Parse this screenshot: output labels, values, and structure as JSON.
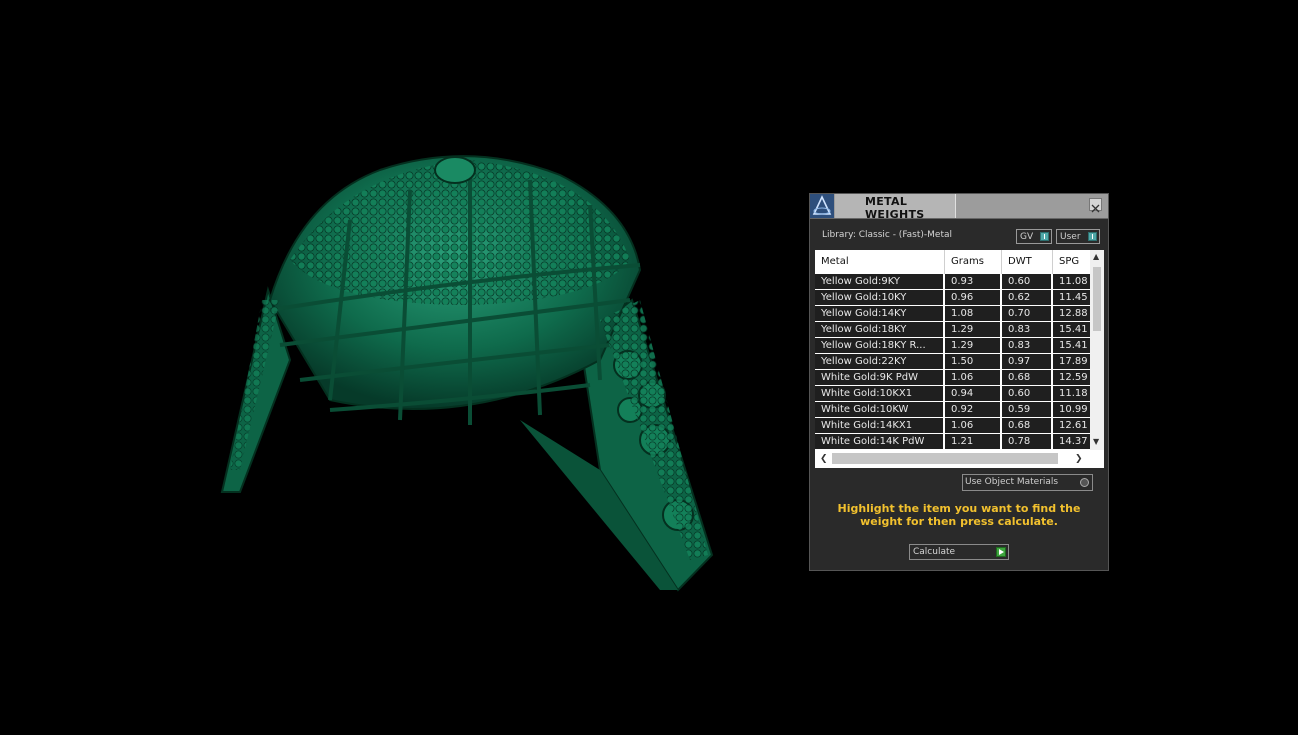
{
  "panel": {
    "title": "METAL WEIGHTS",
    "library_label": "Library: Classic - (Fast)-Metal",
    "gv_label": "GV",
    "user_label": "User",
    "use_object_materials_label": "Use Object Materials",
    "hint": "Highlight the item you want to find the weight for then press calculate.",
    "calculate_label": "Calculate"
  },
  "table": {
    "columns": [
      "Metal",
      "Grams",
      "DWT",
      "SPG"
    ],
    "rows": [
      [
        "Yellow Gold:9KY",
        "0.93",
        "0.60",
        "11.08"
      ],
      [
        "Yellow Gold:10KY",
        "0.96",
        "0.62",
        "11.45"
      ],
      [
        "Yellow Gold:14KY",
        "1.08",
        "0.70",
        "12.88"
      ],
      [
        "Yellow Gold:18KY",
        "1.29",
        "0.83",
        "15.41"
      ],
      [
        "Yellow Gold:18KY R...",
        "1.29",
        "0.83",
        "15.41"
      ],
      [
        "Yellow Gold:22KY",
        "1.50",
        "0.97",
        "17.89"
      ],
      [
        "White Gold:9K PdW",
        "1.06",
        "0.68",
        "12.59"
      ],
      [
        "White Gold:10KX1",
        "0.94",
        "0.60",
        "11.18"
      ],
      [
        "White Gold:10KW",
        "0.92",
        "0.59",
        "10.99"
      ],
      [
        "White Gold:14KX1",
        "1.06",
        "0.68",
        "12.61"
      ],
      [
        "White Gold:14K PdW",
        "1.21",
        "0.78",
        "14.37"
      ]
    ]
  },
  "colors": {
    "model": "#0f6b4c",
    "hint": "#f2c12e",
    "toggle_knob": "#4fa8a8",
    "calculate_go": "#3ea53e"
  }
}
